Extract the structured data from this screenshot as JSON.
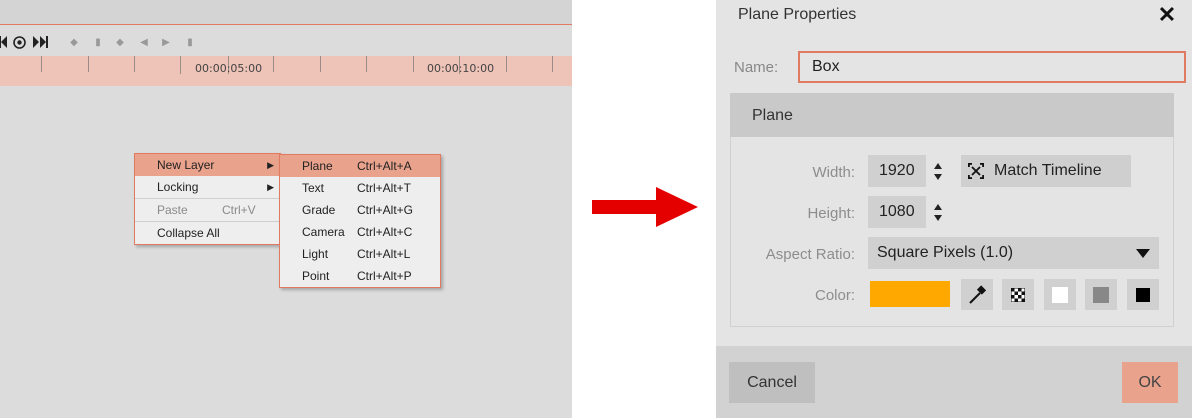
{
  "timeline": {
    "ruler_labels": [
      "00:00:05:00",
      "00:00:10:00"
    ],
    "icons": [
      "step-back-icon",
      "play-icon",
      "step-forward-icon"
    ]
  },
  "context_menu": {
    "items": [
      {
        "label": "New Layer",
        "shortcut": "",
        "submenu": true,
        "highlighted": true,
        "disabled": false
      },
      {
        "label": "Locking",
        "shortcut": "",
        "submenu": true,
        "highlighted": false,
        "disabled": false
      },
      {
        "label": "Paste",
        "shortcut": "Ctrl+V",
        "submenu": false,
        "highlighted": false,
        "disabled": true
      },
      {
        "label": "Collapse All",
        "shortcut": "",
        "submenu": false,
        "highlighted": false,
        "disabled": false
      }
    ]
  },
  "submenu": {
    "items": [
      {
        "label": "Plane",
        "shortcut": "Ctrl+Alt+A",
        "highlighted": true
      },
      {
        "label": "Text",
        "shortcut": "Ctrl+Alt+T",
        "highlighted": false
      },
      {
        "label": "Grade",
        "shortcut": "Ctrl+Alt+G",
        "highlighted": false
      },
      {
        "label": "Camera",
        "shortcut": "Ctrl+Alt+C",
        "highlighted": false
      },
      {
        "label": "Light",
        "shortcut": "Ctrl+Alt+L",
        "highlighted": false
      },
      {
        "label": "Point",
        "shortcut": "Ctrl+Alt+P",
        "highlighted": false
      }
    ]
  },
  "dialog": {
    "title": "Plane Properties",
    "close_icon": "close-icon",
    "name_label": "Name:",
    "name_value": "Box",
    "section_title": "Plane",
    "width_label": "Width:",
    "width_value": "1920",
    "height_label": "Height:",
    "height_value": "1080",
    "match_timeline_label": "Match Timeline",
    "aspect_label": "Aspect Ratio:",
    "aspect_value": "Square Pixels (1.0)",
    "color_label": "Color:",
    "color_value": "#FFA800",
    "cancel_label": "Cancel",
    "ok_label": "OK"
  },
  "colors": {
    "accent": "#E07B62",
    "highlight": "#E9A28C",
    "arrow": "#E50000"
  }
}
